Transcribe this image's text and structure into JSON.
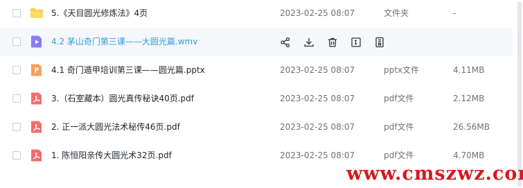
{
  "files": [
    {
      "name": "5.《天目圆光修炼法》4页",
      "date": "2023-02-25 08:07",
      "type": "文件夹",
      "size": "-",
      "icon": "folder-icon",
      "icon_color": "#ffc83d"
    },
    {
      "name": "4.2 茅山奇门第三课——大圆光篇.wmv",
      "date": "",
      "type": "",
      "size": "",
      "icon": "video-icon",
      "icon_color": "#8b7cf6",
      "hovered": true
    },
    {
      "name": "4.1 奇门遁甲培训第三课——圆光篇.pptx",
      "date": "2023-02-25 08:07",
      "type": "pptx文件",
      "size": "4.11MB",
      "icon": "presentation-icon",
      "icon_color": "#f6a05a"
    },
    {
      "name": "3.（石室藏本）圆光真传秘诀40页.pdf",
      "date": "2023-02-25 08:07",
      "type": "pdf文件",
      "size": "2.12MB",
      "icon": "pdf-icon",
      "icon_color": "#f36d6d"
    },
    {
      "name": "2. 正一派大圆光法术秘传46页.pdf",
      "date": "2023-02-25 08:07",
      "type": "pdf文件",
      "size": "26.56MB",
      "icon": "pdf-icon",
      "icon_color": "#f36d6d"
    },
    {
      "name": "1. 陈恒阳亲传大圆光术32页.pdf",
      "date": "2023-02-25 08:07",
      "type": "pdf文件",
      "size": "4.70MB",
      "icon": "pdf-icon",
      "icon_color": "#f36d6d"
    }
  ],
  "row_actions": [
    "share-icon",
    "download-icon",
    "delete-icon",
    "rename-icon",
    "more-icon"
  ],
  "watermark": {
    "text": "www.cmszwz.com",
    "color": "#d8181f"
  },
  "colors": {
    "accent": "#2ba0db",
    "hover_background": "#f6f7fb",
    "secondary_text": "#6d717a"
  }
}
